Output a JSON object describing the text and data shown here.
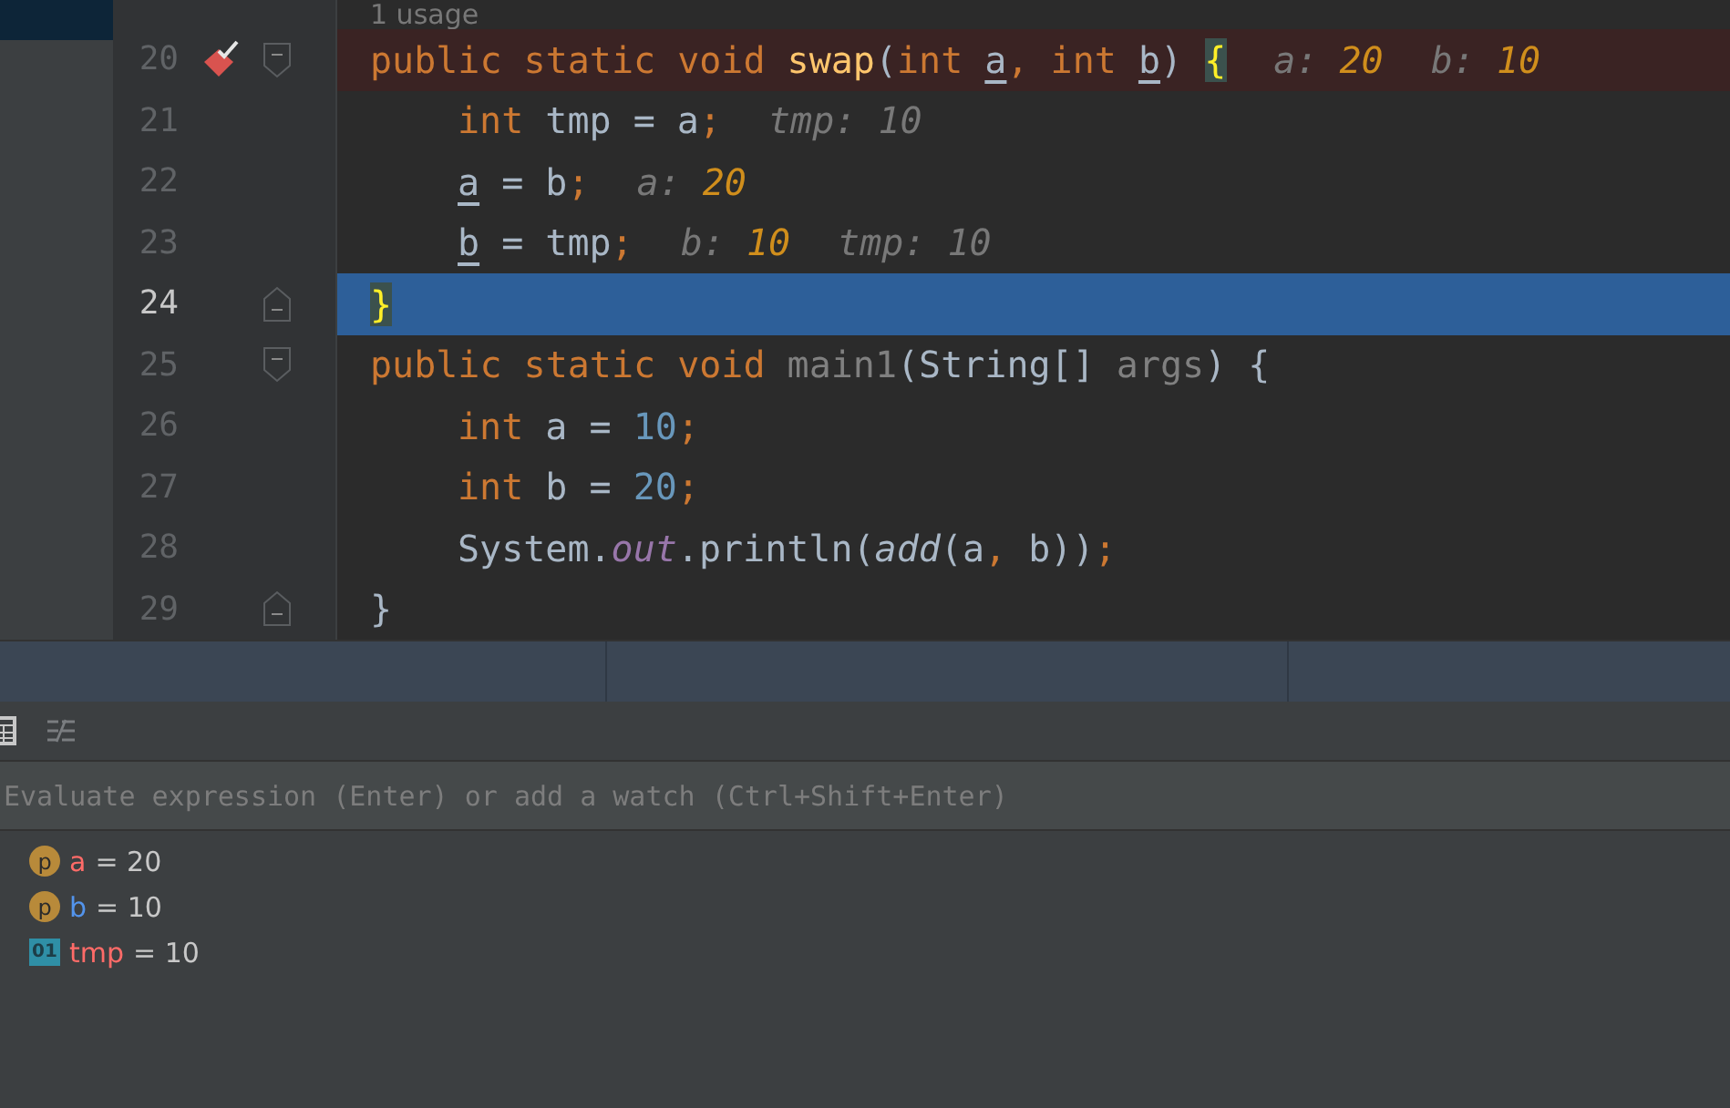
{
  "editor": {
    "usage_hint": "1 usage",
    "lines": [
      {
        "number": "20",
        "kind": "outer",
        "breakpoint": true,
        "current": false,
        "fold_start": true,
        "fold_end": false,
        "tokens": [
          {
            "kind": "keyword",
            "text": "public static void "
          },
          {
            "kind": "func",
            "text": "swap"
          },
          {
            "kind": "plain",
            "text": "("
          },
          {
            "kind": "keyword",
            "text": "int "
          },
          {
            "kind": "param",
            "text": "a"
          },
          {
            "kind": "keyword",
            "text": ", int "
          },
          {
            "kind": "param",
            "text": "b"
          },
          {
            "kind": "plain",
            "text": ") "
          },
          {
            "kind": "brace",
            "text": "{"
          },
          {
            "kind": "hint-name",
            "text": "a:"
          },
          {
            "kind": "hint-value",
            "text": "20"
          },
          {
            "kind": "hint-name",
            "text": "b:"
          },
          {
            "kind": "hint-value",
            "text": "10"
          }
        ]
      },
      {
        "number": "21",
        "kind": "inner",
        "breakpoint": false,
        "current": false,
        "fold_start": false,
        "fold_end": false,
        "tokens": [
          {
            "kind": "keyword",
            "text": "int "
          },
          {
            "kind": "plain",
            "text": "tmp = a"
          },
          {
            "kind": "keyword",
            "text": ";"
          },
          {
            "kind": "hint-name",
            "text": "tmp: 10"
          }
        ]
      },
      {
        "number": "22",
        "kind": "inner",
        "breakpoint": false,
        "current": false,
        "fold_start": false,
        "fold_end": false,
        "tokens": [
          {
            "kind": "param",
            "text": "a"
          },
          {
            "kind": "plain",
            "text": " = b"
          },
          {
            "kind": "keyword",
            "text": ";"
          },
          {
            "kind": "hint-name",
            "text": "a:"
          },
          {
            "kind": "hint-value",
            "text": "20"
          }
        ]
      },
      {
        "number": "23",
        "kind": "inner",
        "breakpoint": false,
        "current": false,
        "fold_start": false,
        "fold_end": false,
        "tokens": [
          {
            "kind": "param",
            "text": "b"
          },
          {
            "kind": "plain",
            "text": " = tmp"
          },
          {
            "kind": "keyword",
            "text": ";"
          },
          {
            "kind": "hint-name",
            "text": "b:"
          },
          {
            "kind": "hint-value",
            "text": "10"
          },
          {
            "kind": "hint-name",
            "text": "tmp: 10"
          }
        ]
      },
      {
        "number": "24",
        "kind": "outer",
        "breakpoint": false,
        "current": true,
        "fold_start": false,
        "fold_end": true,
        "tokens": [
          {
            "kind": "brace",
            "text": "}"
          }
        ]
      },
      {
        "number": "25",
        "kind": "outer",
        "breakpoint": false,
        "current": false,
        "fold_start": true,
        "fold_end": false,
        "tokens": [
          {
            "kind": "keyword",
            "text": "public static void "
          },
          {
            "kind": "unused",
            "text": "main1"
          },
          {
            "kind": "plain",
            "text": "(String[] "
          },
          {
            "kind": "unused",
            "text": "args"
          },
          {
            "kind": "plain",
            "text": ") {"
          }
        ]
      },
      {
        "number": "26",
        "kind": "inner",
        "breakpoint": false,
        "current": false,
        "fold_start": false,
        "fold_end": false,
        "tokens": [
          {
            "kind": "keyword",
            "text": "int "
          },
          {
            "kind": "plain",
            "text": "a = "
          },
          {
            "kind": "number",
            "text": "10"
          },
          {
            "kind": "keyword",
            "text": ";"
          }
        ]
      },
      {
        "number": "27",
        "kind": "inner",
        "breakpoint": false,
        "current": false,
        "fold_start": false,
        "fold_end": false,
        "tokens": [
          {
            "kind": "keyword",
            "text": "int "
          },
          {
            "kind": "plain",
            "text": "b = "
          },
          {
            "kind": "number",
            "text": "20"
          },
          {
            "kind": "keyword",
            "text": ";"
          }
        ]
      },
      {
        "number": "28",
        "kind": "inner",
        "breakpoint": false,
        "current": false,
        "fold_start": false,
        "fold_end": false,
        "tokens": [
          {
            "kind": "plain",
            "text": "System."
          },
          {
            "kind": "static-field",
            "text": "out"
          },
          {
            "kind": "plain",
            "text": ".println("
          },
          {
            "kind": "static-call",
            "text": "add"
          },
          {
            "kind": "plain",
            "text": "(a"
          },
          {
            "kind": "keyword",
            "text": ", "
          },
          {
            "kind": "plain",
            "text": "b))"
          },
          {
            "kind": "keyword",
            "text": ";"
          }
        ]
      },
      {
        "number": "29",
        "kind": "outer",
        "breakpoint": false,
        "current": false,
        "fold_start": false,
        "fold_end": true,
        "tokens": [
          {
            "kind": "plain",
            "text": "}"
          }
        ]
      }
    ]
  },
  "debugger": {
    "watch_field": {
      "placeholder": "Evaluate expression (Enter) or add a watch (Ctrl+Shift+Enter)"
    },
    "variables": [
      {
        "kind": "parameter",
        "badge": "p",
        "name": "a",
        "value": "= 20",
        "color": "#ff6b68"
      },
      {
        "kind": "parameter",
        "badge": "p",
        "name": "b",
        "value": "= 10",
        "color": "#5394ec"
      },
      {
        "kind": "local",
        "badge": "01",
        "name": "tmp",
        "value": "= 10",
        "color": "#ff6b68"
      }
    ]
  }
}
